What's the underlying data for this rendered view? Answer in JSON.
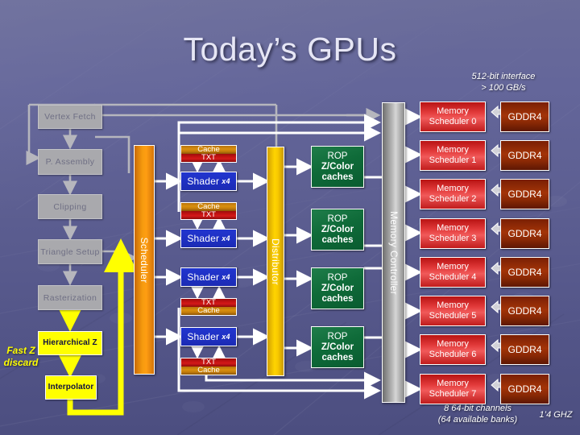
{
  "slide": {
    "title": "Today’s GPUs",
    "background_color": "#5b5d8c"
  },
  "annotations": {
    "memory_interface": "512-bit interface",
    "memory_bandwidth": "> 100 GB/s",
    "channels": "8 64-bit channels",
    "banks": "(64 available banks)",
    "clock": "1’4 GHZ",
    "fast_z_line1": "Fast Z",
    "fast_z_line2": "discard"
  },
  "front_end": {
    "stages": [
      {
        "label": "Vertex Fetch",
        "style": "grey"
      },
      {
        "label": "P. Assembly",
        "style": "grey"
      },
      {
        "label": "Clipping",
        "style": "grey"
      },
      {
        "label": "Triangle Setup",
        "style": "grey"
      },
      {
        "label": "Rasterization",
        "style": "grey"
      },
      {
        "label": "Hierarchical Z",
        "style": "yellow"
      },
      {
        "label": "Interpolator",
        "style": "yellow"
      }
    ]
  },
  "scheduler": {
    "label": "Scheduler",
    "color": "#ff9e12"
  },
  "distributor": {
    "label": "Distributor",
    "color": "#ffd400"
  },
  "memory_controller": {
    "label": "Memory Controller",
    "color": "#c0c0c0"
  },
  "shader_column": {
    "units": [
      {
        "shader": "Shader",
        "multiplier": "x4",
        "cache_label": "Cache",
        "txt_label": "TXT",
        "cache_on_top": true
      },
      {
        "shader": "Shader",
        "multiplier": "x4",
        "cache_label": "Cache",
        "txt_label": "TXT",
        "cache_on_top": true
      },
      {
        "shader": "Shader",
        "multiplier": "x4",
        "cache_label": "Cache",
        "txt_label": "TXT",
        "cache_on_top": false
      },
      {
        "shader": "Shader",
        "multiplier": "x4",
        "cache_label": "Cache",
        "txt_label": "TXT",
        "cache_on_top": false
      }
    ]
  },
  "rop_column": {
    "units": [
      {
        "line1": "ROP",
        "line2": "Z/Color",
        "line3": "caches"
      },
      {
        "line1": "ROP",
        "line2": "Z/Color",
        "line3": "caches"
      },
      {
        "line1": "ROP",
        "line2": "Z/Color",
        "line3": "caches"
      },
      {
        "line1": "ROP",
        "line2": "Z/Color",
        "line3": "caches"
      }
    ]
  },
  "memory_column": {
    "schedulers": [
      {
        "line1": "Memory",
        "line2": "Scheduler 0",
        "dram": "GDDR4"
      },
      {
        "line1": "Memory",
        "line2": "Scheduler 1",
        "dram": "GDDR4"
      },
      {
        "line1": "Memory",
        "line2": "Scheduler 2",
        "dram": "GDDR4"
      },
      {
        "line1": "Memory",
        "line2": "Scheduler 3",
        "dram": "GDDR4"
      },
      {
        "line1": "Memory",
        "line2": "Scheduler 4",
        "dram": "GDDR4"
      },
      {
        "line1": "Memory",
        "line2": "Scheduler 5",
        "dram": "GDDR4"
      },
      {
        "line1": "Memory",
        "line2": "Scheduler 6",
        "dram": "GDDR4"
      },
      {
        "line1": "Memory",
        "line2": "Scheduler 7",
        "dram": "GDDR4"
      }
    ]
  }
}
